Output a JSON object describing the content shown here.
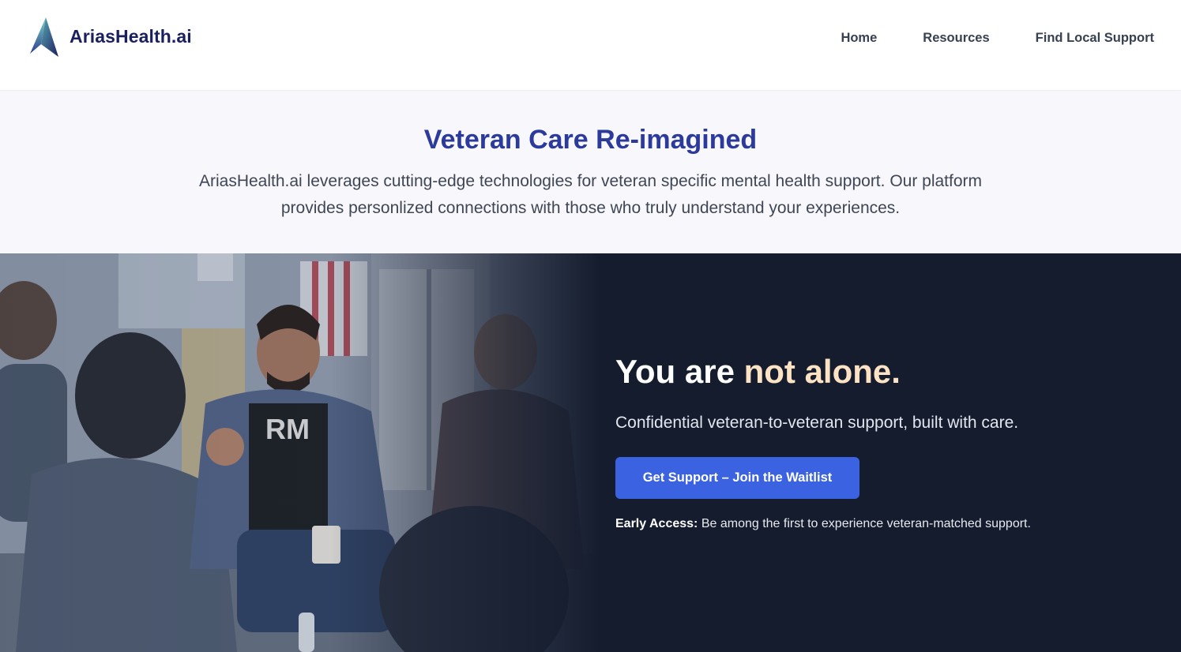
{
  "header": {
    "brand_name": "AriasHealth.ai",
    "logo_icon": "mountain-peak-logo-icon",
    "nav": [
      {
        "label": "Home"
      },
      {
        "label": "Resources"
      },
      {
        "label": "Find Local Support"
      }
    ]
  },
  "intro": {
    "title": "Veteran Care Re-imagined",
    "description": "AriasHealth.ai leverages cutting-edge technologies for veteran specific mental health support. Our platform provides personlized connections with those who truly understand your experiences."
  },
  "hero": {
    "image_shirt_text": "RM",
    "title_prefix": "You are ",
    "title_accent": "not alone.",
    "subtitle": "Confidential veteran-to-veteran support, built with care.",
    "cta_label": "Get Support – Join the Waitlist",
    "early_access_label": "Early Access:",
    "early_access_text": " Be among the first to experience veteran-matched support."
  },
  "colors": {
    "brand_navy": "#1a1f5e",
    "intro_title": "#2b3a9b",
    "intro_background": "#f7f7fc",
    "hero_background": "#141c2e",
    "accent_peach": "#fde3c4",
    "cta_blue": "#3b62e0"
  }
}
